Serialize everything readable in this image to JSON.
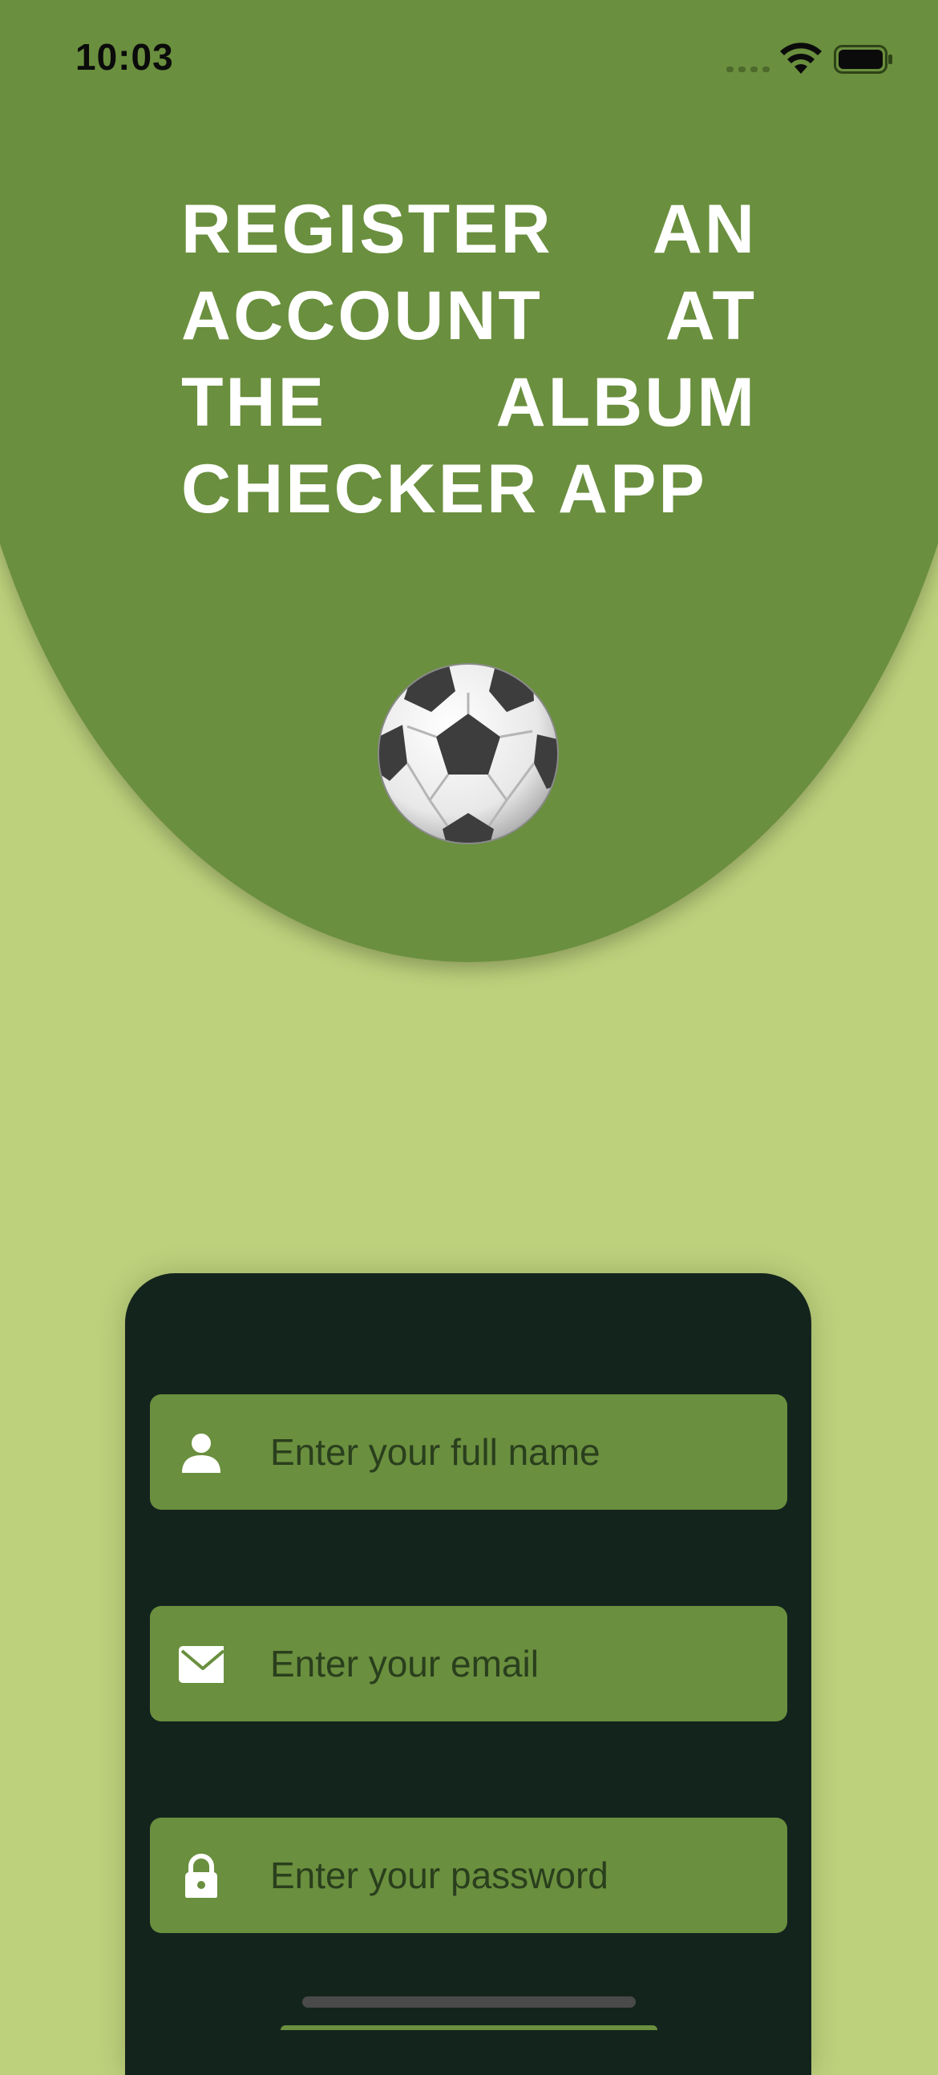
{
  "status_bar": {
    "time": "10:03"
  },
  "header": {
    "title": "REGISTER AN ACCOUNT AT THE ALBUM CHECKER APP",
    "icon": "soccer-ball-icon"
  },
  "form": {
    "fields": [
      {
        "icon": "person-icon",
        "placeholder": "Enter your full name",
        "value": ""
      },
      {
        "icon": "mail-icon",
        "placeholder": "Enter your email",
        "value": ""
      },
      {
        "icon": "lock-icon",
        "placeholder": "Enter your password",
        "value": ""
      }
    ]
  },
  "colors": {
    "page_background": "#bdd17c",
    "header_background": "#6a8f3e",
    "card_background": "#13241d",
    "field_background": "#6a8f3e",
    "title_text": "#ffffff",
    "placeholder_text": "#2a3f1d"
  }
}
